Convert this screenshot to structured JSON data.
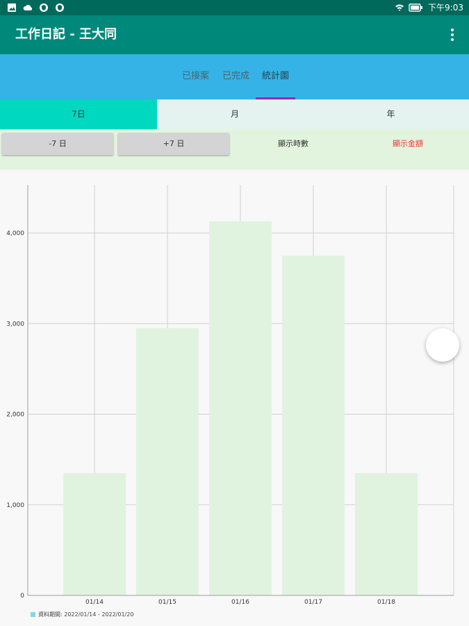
{
  "status_bar": {
    "icons": [
      "image-icon",
      "cloud-icon",
      "shield-icon",
      "shield-icon",
      "wifi-icon",
      "battery-icon"
    ],
    "time": "下午9:03"
  },
  "app_bar": {
    "title": "工作日記 - 王大同",
    "menu_icon": "more-vert-icon"
  },
  "tabs": [
    {
      "label": "已接案",
      "active": false
    },
    {
      "label": "已完成",
      "active": false
    },
    {
      "label": "統計圖",
      "active": true
    }
  ],
  "period": {
    "options": [
      {
        "label": "7日",
        "active": true
      },
      {
        "label": "月",
        "active": false
      },
      {
        "label": "年",
        "active": false
      }
    ]
  },
  "controls": {
    "prev_label": "-7 日",
    "next_label": "+7 日",
    "show_hours_label": "顯示時數",
    "show_amount_label": "顯示金額"
  },
  "colors": {
    "status_bar": "#00695c",
    "app_bar": "#00897b",
    "tab_bar": "#35b3e6",
    "tab_indicator": "#9c27b0",
    "period_active": "#00d9c0",
    "bar_fill": "#e0f3df",
    "amount_text": "#e53935",
    "legend_swatch": "#80d8f0"
  },
  "chart_data": {
    "type": "bar",
    "categories": [
      "01/14",
      "01/15",
      "01/16",
      "01/17",
      "01/18"
    ],
    "values": [
      1350,
      2950,
      4130,
      3750,
      1350
    ],
    "ylim": [
      0,
      4530
    ],
    "yticks": [
      0,
      1000,
      2000,
      3000,
      4000
    ],
    "ytick_labels": [
      "0",
      "1,000",
      "2,000",
      "3,000",
      "4,000"
    ],
    "grid": true,
    "legend": {
      "position": "bottom-left",
      "label": "資料期間: 2022/01/14 - 2022/01/20"
    }
  }
}
